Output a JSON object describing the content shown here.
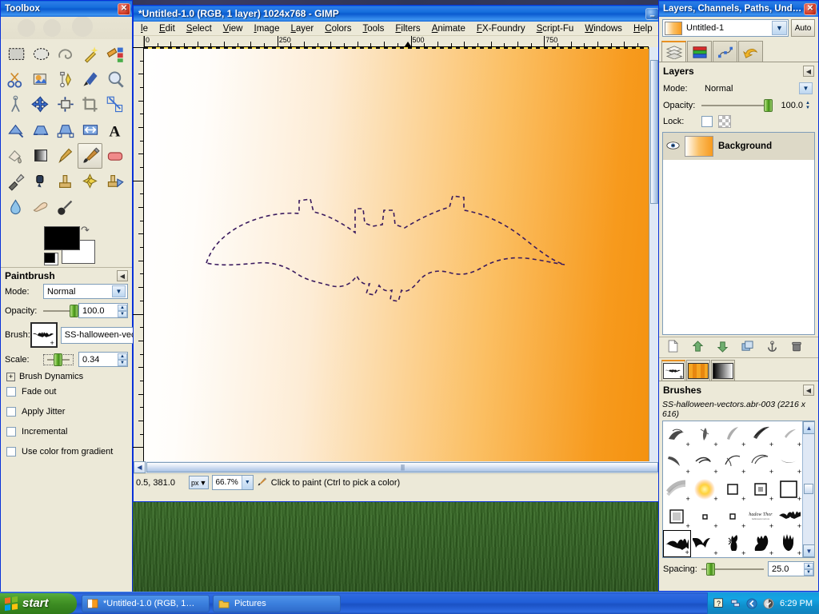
{
  "desktop": {
    "wallpaper_name": "grass-field-wallpaper"
  },
  "toolbox": {
    "title": "Toolbox",
    "close_label": "✕",
    "tools": [
      {
        "name": "rect-select-tool",
        "title": "Rectangle Select"
      },
      {
        "name": "ellipse-select-tool",
        "title": "Ellipse Select"
      },
      {
        "name": "free-select-tool",
        "title": "Free Select (Lasso)"
      },
      {
        "name": "fuzzy-select-tool",
        "title": "Fuzzy Select (Magic Wand)"
      },
      {
        "name": "select-by-color-tool",
        "title": "Select By Color"
      },
      {
        "name": "scissors-select-tool",
        "title": "Intelligent Scissors"
      },
      {
        "name": "foreground-select-tool",
        "title": "Foreground Select"
      },
      {
        "name": "paths-tool",
        "title": "Paths"
      },
      {
        "name": "color-picker-tool",
        "title": "Color Picker"
      },
      {
        "name": "zoom-tool",
        "title": "Zoom"
      },
      {
        "name": "measure-tool",
        "title": "Measure"
      },
      {
        "name": "move-tool",
        "title": "Move"
      },
      {
        "name": "align-tool",
        "title": "Alignment"
      },
      {
        "name": "crop-tool",
        "title": "Crop"
      },
      {
        "name": "rotate-tool",
        "title": "Rotate"
      },
      {
        "name": "scale-tool",
        "title": "Scale"
      },
      {
        "name": "shear-tool",
        "title": "Shear"
      },
      {
        "name": "perspective-tool",
        "title": "Perspective"
      },
      {
        "name": "flip-tool",
        "title": "Flip"
      },
      {
        "name": "text-tool",
        "title": "Text"
      },
      {
        "name": "bucket-fill-tool",
        "title": "Bucket Fill"
      },
      {
        "name": "gradient-tool",
        "title": "Blend / Gradient"
      },
      {
        "name": "pencil-tool",
        "title": "Pencil"
      },
      {
        "name": "paintbrush-tool",
        "title": "Paintbrush"
      },
      {
        "name": "eraser-tool",
        "title": "Eraser"
      },
      {
        "name": "airbrush-tool",
        "title": "Airbrush"
      },
      {
        "name": "ink-tool",
        "title": "Ink"
      },
      {
        "name": "clone-tool",
        "title": "Clone"
      },
      {
        "name": "heal-tool",
        "title": "Heal"
      },
      {
        "name": "perspective-clone-tool",
        "title": "Perspective Clone"
      },
      {
        "name": "blur-sharpen-tool",
        "title": "Blur / Sharpen"
      },
      {
        "name": "smudge-tool",
        "title": "Smudge"
      },
      {
        "name": "dodge-burn-tool",
        "title": "Dodge / Burn"
      }
    ],
    "selected_tool": "paintbrush-tool",
    "colors": {
      "foreground": "#000000",
      "background": "#ffffff",
      "swap_icon": "swap-colors-icon"
    }
  },
  "tool_options": {
    "title": "Paintbrush",
    "mode_label": "Mode:",
    "mode_value": "Normal",
    "opacity_label": "Opacity:",
    "opacity_value": "100.0",
    "opacity_percent": 100,
    "brush_label": "Brush:",
    "brush_value": "SS-halloween-vect",
    "scale_label": "Scale:",
    "scale_value": "0.34",
    "scale_percent": 34,
    "brush_dynamics_label": "Brush Dynamics",
    "checkboxes": [
      {
        "label": "Fade out",
        "checked": false,
        "name": "fade-out-checkbox"
      },
      {
        "label": "Apply Jitter",
        "checked": false,
        "name": "apply-jitter-checkbox"
      },
      {
        "label": "Incremental",
        "checked": false,
        "name": "incremental-checkbox"
      },
      {
        "label": "Use color from gradient",
        "checked": false,
        "name": "use-color-from-gradient-checkbox"
      }
    ]
  },
  "image_window": {
    "title": "*Untitled-1.0 (RGB, 1 layer) 1024x768 - GIMP",
    "minimize_label": "–",
    "menus": [
      "le",
      "Edit",
      "Select",
      "View",
      "Image",
      "Layer",
      "Colors",
      "Tools",
      "Filters",
      "Animate",
      "FX-Foundry",
      "Script-Fu",
      "Windows",
      "Help"
    ],
    "ruler_labels": [
      "0",
      "250",
      "500",
      "750"
    ],
    "status": {
      "position": "0.5, 381.0",
      "unit": "px",
      "zoom": "66.7%",
      "message": "Click to paint (Ctrl to pick a color)"
    },
    "canvas": {
      "gradient_from": "#ffffff",
      "gradient_to": "#f4920f",
      "selection_name": "bat-selection-outline"
    }
  },
  "dock": {
    "title": "Layers, Channels, Paths, Undo -...",
    "close_label": "✕",
    "image_name": "Untitled-1",
    "auto_label": "Auto",
    "tabs": [
      {
        "name": "tab-layers",
        "label": "Layers"
      },
      {
        "name": "tab-channels",
        "label": "Channels"
      },
      {
        "name": "tab-paths",
        "label": "Paths"
      },
      {
        "name": "tab-undo",
        "label": "Undo History"
      }
    ],
    "layers_panel": {
      "title": "Layers",
      "mode_label": "Mode:",
      "mode_value": "Normal",
      "opacity_label": "Opacity:",
      "opacity_value": "100.0",
      "opacity_percent": 100,
      "lock_label": "Lock:",
      "layers": [
        {
          "name": "Background",
          "visible": true
        }
      ]
    },
    "layer_buttons": [
      {
        "name": "new-layer-button",
        "title": "New Layer"
      },
      {
        "name": "raise-layer-button",
        "title": "Raise Layer"
      },
      {
        "name": "lower-layer-button",
        "title": "Lower Layer"
      },
      {
        "name": "duplicate-layer-button",
        "title": "Duplicate Layer"
      },
      {
        "name": "anchor-layer-button",
        "title": "Anchor Layer"
      },
      {
        "name": "delete-layer-button",
        "title": "Delete Layer"
      }
    ],
    "bottom_tabs": [
      {
        "name": "tab-brushes",
        "label": "Brushes"
      },
      {
        "name": "tab-patterns",
        "label": "Patterns"
      },
      {
        "name": "tab-gradients",
        "label": "Gradients"
      }
    ],
    "brushes_panel": {
      "title": "Brushes",
      "selected_brush": "SS-halloween-vectors.abr-003 (2216 x 616)",
      "spacing_label": "Spacing:",
      "spacing_value": "25.0",
      "spacing_percent": 25,
      "cells": [
        {
          "glyph": "smear-a",
          "sel": false
        },
        {
          "glyph": "smear-b",
          "sel": false
        },
        {
          "glyph": "smear-c",
          "sel": false
        },
        {
          "glyph": "smear-d",
          "sel": false
        },
        {
          "glyph": "smear-e",
          "sel": false
        },
        {
          "glyph": "smear-f",
          "sel": false
        },
        {
          "glyph": "swirl-a",
          "sel": false
        },
        {
          "glyph": "swirl-b",
          "sel": false
        },
        {
          "glyph": "swirl-c",
          "sel": false
        },
        {
          "glyph": "swirl-d",
          "sel": false
        },
        {
          "glyph": "streak",
          "sel": false
        },
        {
          "glyph": "glow-sun",
          "sel": false
        },
        {
          "glyph": "square-sm",
          "sel": false
        },
        {
          "glyph": "square-md",
          "sel": false
        },
        {
          "glyph": "square-lg",
          "sel": false
        },
        {
          "glyph": "square-soft",
          "sel": false
        },
        {
          "glyph": "dot-sm",
          "sel": false
        },
        {
          "glyph": "dot-md",
          "sel": false
        },
        {
          "glyph": "script-text",
          "sel": false
        },
        {
          "glyph": "bat-fly",
          "sel": false
        },
        {
          "glyph": "bat-wide",
          "sel": true
        },
        {
          "glyph": "bat-small",
          "sel": false
        },
        {
          "glyph": "cat-stand",
          "sel": false
        },
        {
          "glyph": "cat-sit",
          "sel": false
        },
        {
          "glyph": "hand-print",
          "sel": false
        }
      ]
    }
  },
  "taskbar": {
    "start_label": "start",
    "items": [
      {
        "label": "*Untitled-1.0 (RGB, 1…",
        "icon": "gimp-image-icon"
      },
      {
        "label": "Pictures",
        "icon": "folder-icon"
      }
    ],
    "tray": {
      "help_icon": "help-tray-icon",
      "network_icon": "network-tray-icon",
      "chevron_icon": "show-hidden-icons-icon",
      "shield_icon": "security-center-icon",
      "clock": "6:29 PM"
    }
  }
}
